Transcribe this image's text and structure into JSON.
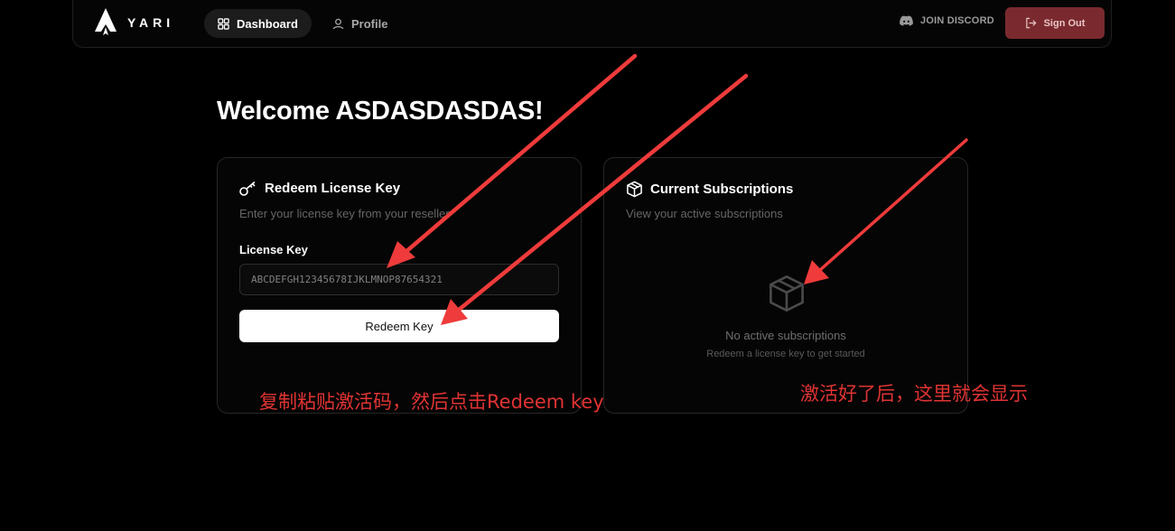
{
  "nav": {
    "brand": "YARI",
    "items": [
      {
        "label": "Dashboard",
        "icon": "grid-icon",
        "active": true
      },
      {
        "label": "Profile",
        "icon": "user-icon",
        "active": false
      }
    ],
    "discord_label": "JOIN DISCORD",
    "signout_label": "Sign Out"
  },
  "welcome": "Welcome ASDASDASDAS!",
  "redeem_card": {
    "title": "Redeem License Key",
    "subtitle": "Enter your license key from your reseller",
    "field_label": "License Key",
    "input_placeholder": "ABCDEFGH12345678IJKLMNOP87654321",
    "button_label": "Redeem Key"
  },
  "subscriptions_card": {
    "title": "Current Subscriptions",
    "subtitle": "View your active subscriptions",
    "empty_title": "No active subscriptions",
    "empty_subtitle": "Redeem a license key to get started"
  },
  "annotations": {
    "left": "复制粘贴激活码，然后点击Redeem key",
    "right": "激活好了后，这里就会显示"
  },
  "colors": {
    "background": "#000000",
    "signout_bg": "#7a2a2e",
    "annotation": "#e03333"
  }
}
